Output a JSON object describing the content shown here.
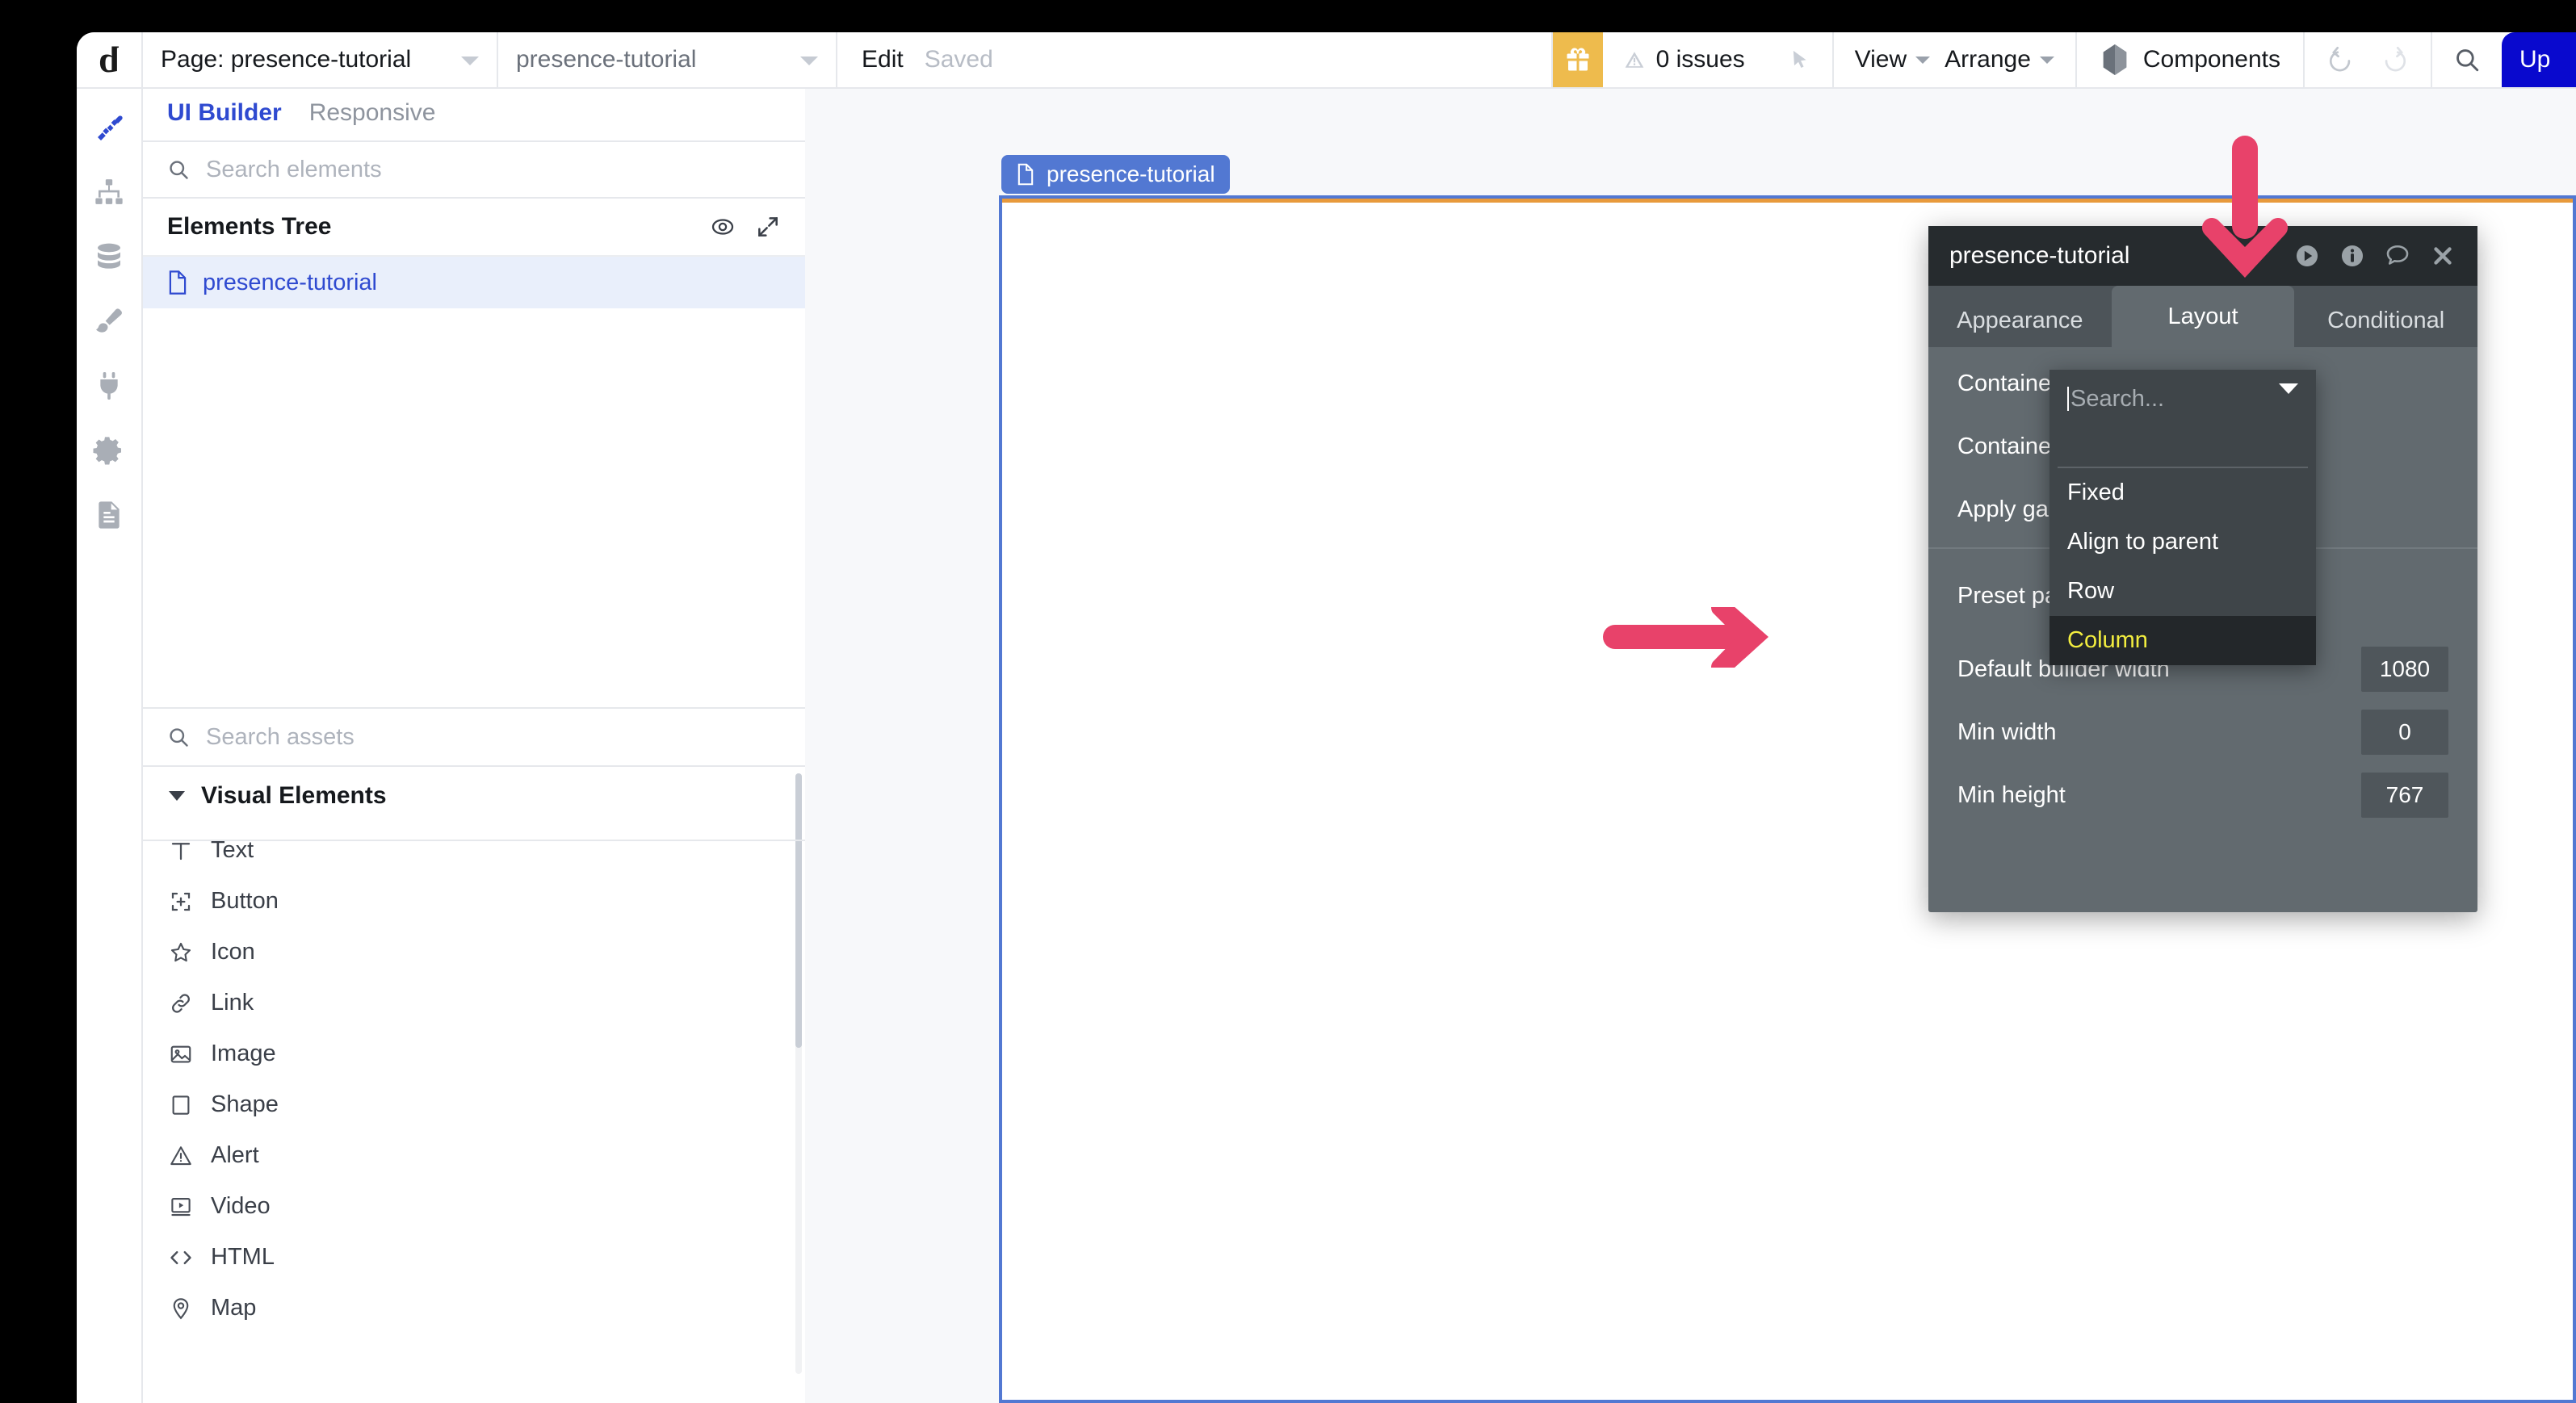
{
  "topbar": {
    "logo": "b",
    "page_selector_label": "Page: presence-tutorial",
    "page_name": "presence-tutorial",
    "edit_label": "Edit",
    "saved_label": "Saved",
    "gift_icon": "gift-icon",
    "issues_label": "0 issues",
    "pointer_icon": "cursor-arrow-icon",
    "view_label": "View",
    "arrange_label": "Arrange",
    "components_label": "Components",
    "components_icon": "cube-icon",
    "undo_icon": "undo-icon",
    "redo_icon": "redo-icon",
    "search_icon": "search-icon",
    "upgrade_label": "Up",
    "accent_blue": "#0909CE",
    "gift_bg": "#EEBB4D"
  },
  "rail": {
    "items": [
      {
        "name": "design-tool-icon",
        "active": true
      },
      {
        "name": "workflow-icon",
        "active": false
      },
      {
        "name": "data-icon",
        "active": false
      },
      {
        "name": "styles-brush-icon",
        "active": false
      },
      {
        "name": "plugins-plug-icon",
        "active": false
      },
      {
        "name": "settings-gear-icon",
        "active": false
      },
      {
        "name": "logs-document-icon",
        "active": false
      }
    ]
  },
  "leftpanel": {
    "tabs": [
      {
        "label": "UI Builder",
        "active": true
      },
      {
        "label": "Responsive",
        "active": false
      }
    ],
    "element_search_placeholder": "Search elements",
    "element_search_value": "",
    "tree_title": "Elements Tree",
    "tree_eye_icon": "eye-icon",
    "tree_expand_icon": "expand-icon",
    "tree_items": [
      {
        "label": "presence-tutorial",
        "icon": "page-document-icon",
        "selected": true
      }
    ],
    "assets_search_placeholder": "Search assets",
    "assets_search_value": "",
    "group_label": "Visual Elements",
    "elements": [
      {
        "label": "Text",
        "icon": "text-icon"
      },
      {
        "label": "Button",
        "icon": "button-icon"
      },
      {
        "label": "Icon",
        "icon": "star-icon"
      },
      {
        "label": "Link",
        "icon": "link-icon"
      },
      {
        "label": "Image",
        "icon": "image-icon"
      },
      {
        "label": "Shape",
        "icon": "shape-icon"
      },
      {
        "label": "Alert",
        "icon": "alert-icon"
      },
      {
        "label": "Video",
        "icon": "video-icon"
      },
      {
        "label": "HTML",
        "icon": "code-icon"
      },
      {
        "label": "Map",
        "icon": "map-pin-icon"
      }
    ]
  },
  "canvas": {
    "page_chip_label": "presence-tutorial",
    "page_chip_icon": "page-document-icon",
    "chip_bg": "#5278d2",
    "frame_border_color": "#5278d2",
    "frame_highlight_color": "#e89a3c"
  },
  "property_panel": {
    "title": "presence-tutorial",
    "header_icons": [
      "preview-play-icon",
      "info-icon",
      "comment-icon",
      "close-icon"
    ],
    "tabs": [
      {
        "label": "Appearance",
        "active": false
      },
      {
        "label": "Layout",
        "active": true
      },
      {
        "label": "Conditional",
        "active": false
      }
    ],
    "rows": [
      {
        "label": "Container layout",
        "value": ""
      },
      {
        "label": "Container alignment",
        "value": ""
      },
      {
        "label": "Apply gap spacing betw",
        "value": ""
      }
    ],
    "rows2": [
      {
        "label": "Preset page width",
        "value": ""
      }
    ],
    "rows3": [
      {
        "label": "Default builder width",
        "value": "1080"
      },
      {
        "label": "Min width",
        "value": "0"
      },
      {
        "label": "Min height",
        "value": "767"
      }
    ]
  },
  "dropdown": {
    "search_placeholder": "Search...",
    "search_value": "",
    "options": [
      {
        "label": "Fixed",
        "selected": false
      },
      {
        "label": "Align to parent",
        "selected": false
      },
      {
        "label": "Row",
        "selected": false
      },
      {
        "label": "Column",
        "selected": true
      }
    ],
    "selected_color": "#f2ed3f",
    "selected_bg": "#23272a"
  },
  "annotations": {
    "color": "#E8426A",
    "arrows": [
      {
        "name": "arrow-down-to-layout-tab",
        "direction": "down"
      },
      {
        "name": "arrow-right-to-container-layout",
        "direction": "right"
      }
    ]
  }
}
